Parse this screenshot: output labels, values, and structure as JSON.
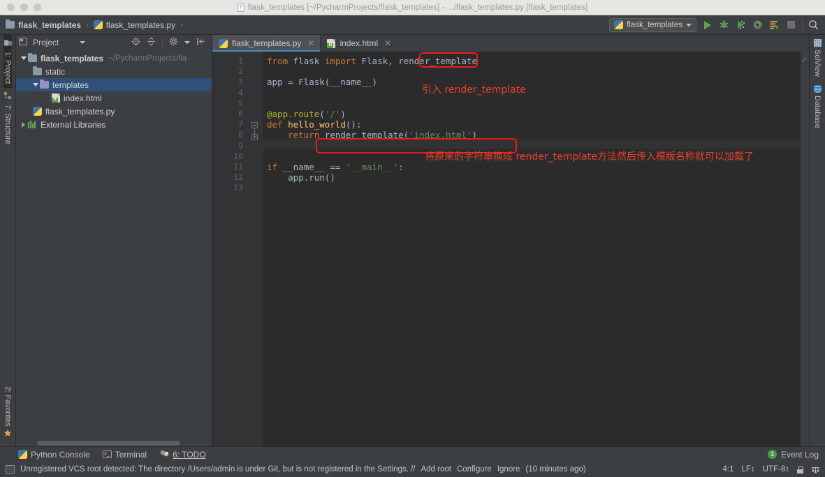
{
  "window": {
    "title": "flask_templates [~/PycharmProjects/flask_templates] - .../flask_templates.py [flask_templates]",
    "title_icon": "python-file-icon"
  },
  "breadcrumb": {
    "items": [
      {
        "label": "flask_templates",
        "icon": "folder-icon"
      },
      {
        "label": "flask_templates.py",
        "icon": "python-file-icon"
      }
    ],
    "separator": "›"
  },
  "toolbar": {
    "run_config": "flask_templates",
    "buttons": [
      {
        "name": "run-button",
        "label": "Run"
      },
      {
        "name": "debug-button",
        "label": "Debug"
      },
      {
        "name": "run-coverage-button",
        "label": "Run with Coverage"
      },
      {
        "name": "profile-button",
        "label": "Profile"
      },
      {
        "name": "run-manage-button",
        "label": "Run Manage"
      },
      {
        "name": "stop-button",
        "label": "Stop"
      },
      {
        "name": "search-everywhere-button",
        "label": "Search Everywhere"
      }
    ]
  },
  "left_rail": {
    "tabs": [
      {
        "label": "1: Project",
        "active": true
      },
      {
        "label": "7: Structure",
        "active": false
      }
    ],
    "bottom_tabs": [
      {
        "label": "2: Favorites",
        "active": false
      }
    ]
  },
  "right_rail": {
    "tabs": [
      {
        "label": "SciView"
      },
      {
        "label": "Database"
      }
    ]
  },
  "project_panel": {
    "title": "Project",
    "tools": [
      {
        "name": "locate-icon",
        "label": "Select Opened File"
      },
      {
        "name": "collapse-all-icon",
        "label": "Collapse All"
      },
      {
        "name": "settings-gear-icon",
        "label": "Settings"
      },
      {
        "name": "hide-panel-icon",
        "label": "Hide"
      }
    ],
    "tree": [
      {
        "label": "flask_templates",
        "path": "~/PycharmProjects/fla",
        "icon": "folder-icon",
        "indent": 0,
        "expanded": true,
        "bold": true,
        "selected": false
      },
      {
        "label": "static",
        "path": "",
        "icon": "folder-icon",
        "indent": 1,
        "expanded": null,
        "bold": false,
        "selected": false
      },
      {
        "label": "templates",
        "path": "",
        "icon": "folder-violet-icon",
        "indent": 1,
        "expanded": true,
        "bold": false,
        "selected": true
      },
      {
        "label": "index.html",
        "path": "",
        "icon": "html-file-icon",
        "indent": 2,
        "expanded": null,
        "bold": false,
        "selected": false
      },
      {
        "label": "flask_templates.py",
        "path": "",
        "icon": "python-file-icon",
        "indent": 1,
        "expanded": null,
        "bold": false,
        "selected": false
      },
      {
        "label": "External Libraries",
        "path": "",
        "icon": "library-icon",
        "indent": 0,
        "expanded": false,
        "bold": false,
        "selected": false
      }
    ]
  },
  "editor": {
    "tabs": [
      {
        "label": "flask_templates.py",
        "icon": "python-file-icon",
        "active": true
      },
      {
        "label": "index.html",
        "icon": "html-file-icon",
        "active": false
      }
    ],
    "line_numbers": [
      "1",
      "2",
      "3",
      "4",
      "5",
      "6",
      "7",
      "8",
      "9",
      "10",
      "11",
      "12",
      "13"
    ],
    "lines": [
      {
        "n": 1,
        "text": "from flask import Flask, render_template"
      },
      {
        "n": 2,
        "text": ""
      },
      {
        "n": 3,
        "text": "app = Flask(__name__)"
      },
      {
        "n": 4,
        "text": ""
      },
      {
        "n": 5,
        "text": ""
      },
      {
        "n": 6,
        "text": "@app.route('/')"
      },
      {
        "n": 7,
        "text": "def hello_world():"
      },
      {
        "n": 8,
        "text": "    return render_template('index.html')"
      },
      {
        "n": 9,
        "text": ""
      },
      {
        "n": 10,
        "text": ""
      },
      {
        "n": 11,
        "text": "if __name__ == '__main__':"
      },
      {
        "n": 12,
        "text": "    app.run()"
      },
      {
        "n": 13,
        "text": ""
      }
    ]
  },
  "annotations": [
    {
      "name": "annotation-import",
      "text": "引入 render_template"
    },
    {
      "name": "annotation-render",
      "text": "将原来的字符串换成 render_template方法然后传入模版名称就可以加载了"
    }
  ],
  "bottom_bar": {
    "items": [
      {
        "label": "Python Console",
        "icon": "python-icon"
      },
      {
        "label": "Terminal",
        "icon": "terminal-icon"
      },
      {
        "label": "6: TODO",
        "icon": "todo-icon"
      }
    ],
    "event_log": {
      "label": "Event Log",
      "count": "1"
    }
  },
  "status_bar": {
    "message": "Unregistered VCS root detected: The directory /Users/admin is under Git, but is not registered in the Settings. // ",
    "links": [
      "Add root",
      "Configure",
      "Ignore"
    ],
    "time": "(10 minutes ago)",
    "caret": "4:1",
    "line_separator": "LF",
    "encoding": "UTF-8",
    "lock_icon": "lock-icon",
    "git_icon": "git-branch-icon"
  },
  "colors": {
    "accent_red": "#ee1b1b",
    "selection_blue": "#2f5179",
    "editor_bg": "#2b2b2b",
    "panel_bg": "#3c3f41"
  }
}
